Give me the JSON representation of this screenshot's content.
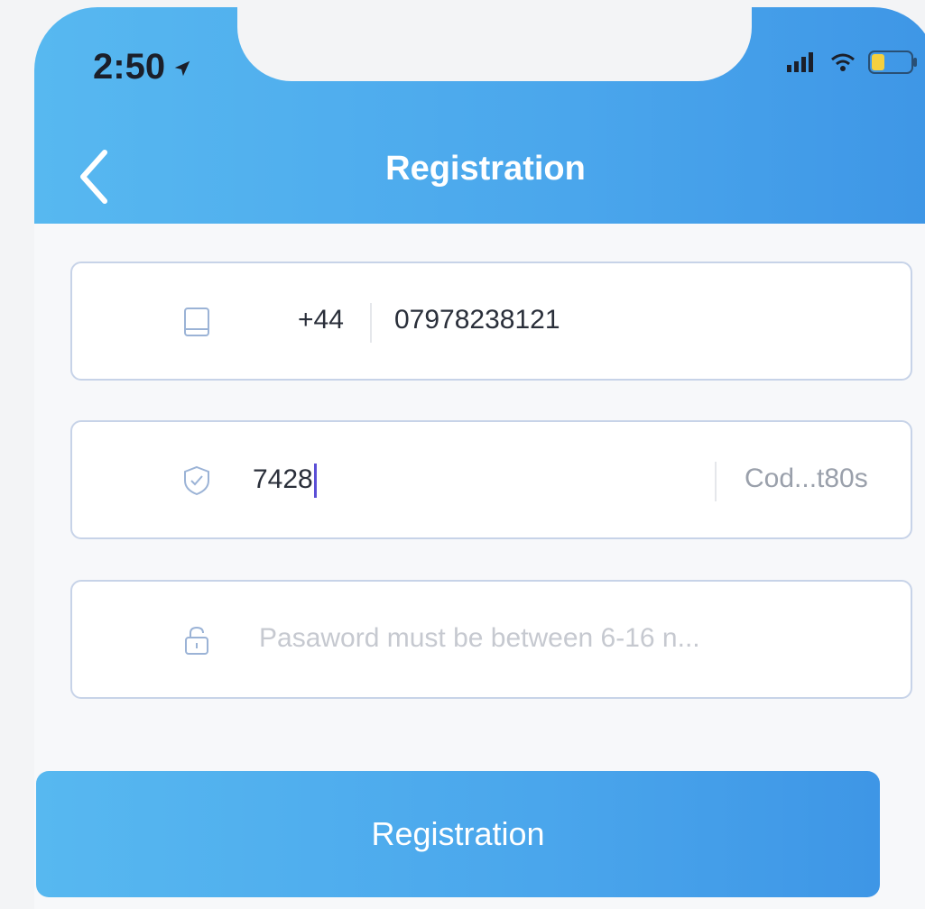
{
  "status_bar": {
    "time": "2:50"
  },
  "nav": {
    "title": "Registration"
  },
  "form": {
    "phone": {
      "country_code": "+44",
      "number": "07978238121"
    },
    "code": {
      "value": "7428",
      "resend_label": "Cod...t80s"
    },
    "password": {
      "placeholder": "Pasaword must be between 6-16 n..."
    },
    "submit_label": "Registration"
  },
  "colors": {
    "accent": "#4aa6ec",
    "field_border": "#c7d3e8",
    "placeholder": "#c6c9d0"
  },
  "icons": [
    "location-arrow-icon",
    "signal-icon",
    "wifi-icon",
    "battery-icon",
    "back-chevron-icon",
    "phone-icon",
    "shield-check-icon",
    "lock-icon"
  ]
}
